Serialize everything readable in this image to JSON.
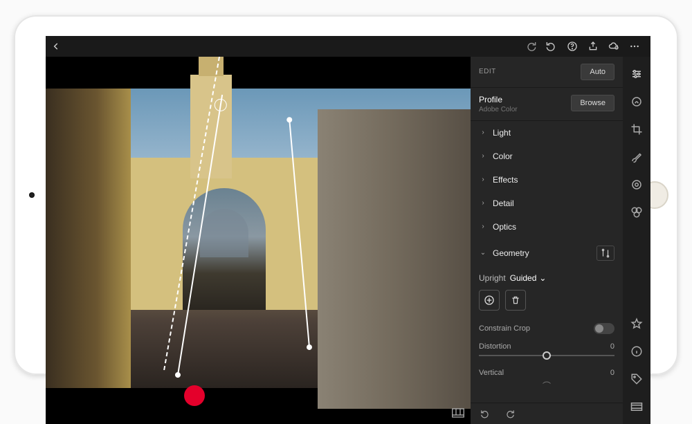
{
  "topbar": {
    "icons": [
      "redo",
      "undo",
      "help",
      "share",
      "cloud-sync",
      "more"
    ]
  },
  "panel": {
    "section_label": "EDIT",
    "auto_button": "Auto",
    "profile": {
      "label": "Profile",
      "value": "Adobe Color",
      "browse": "Browse"
    },
    "groups": [
      {
        "label": "Light",
        "expanded": false
      },
      {
        "label": "Color",
        "expanded": false
      },
      {
        "label": "Effects",
        "expanded": false
      },
      {
        "label": "Detail",
        "expanded": false
      },
      {
        "label": "Optics",
        "expanded": false
      },
      {
        "label": "Geometry",
        "expanded": true
      }
    ],
    "geometry": {
      "upright_label": "Upright",
      "upright_value": "Guided",
      "constrain_crop_label": "Constrain Crop",
      "constrain_crop": false,
      "sliders": [
        {
          "name": "Distortion",
          "value": 0,
          "pos": 50
        },
        {
          "name": "Vertical",
          "value": 0,
          "pos": 50
        }
      ]
    }
  },
  "toolstrip": [
    "adjust",
    "healing",
    "crop",
    "brush",
    "gradient",
    "presets"
  ],
  "toolstrip_bottom": [
    "star",
    "info",
    "tag",
    "filmstrip"
  ],
  "colors": {
    "accent_red": "#e4002b",
    "panel_bg": "#262626"
  }
}
